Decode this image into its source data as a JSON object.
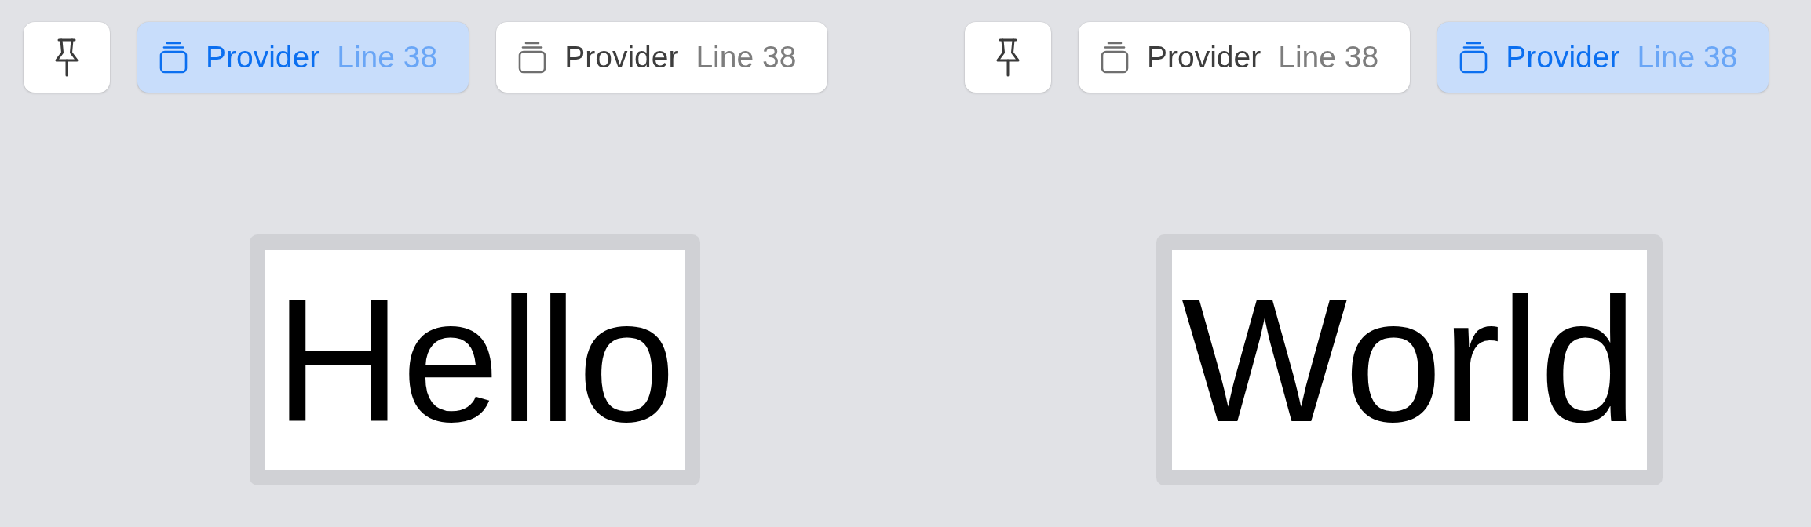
{
  "previews": [
    {
      "tabs": [
        {
          "label": "Provider",
          "detail": "Line 38",
          "selected": true
        },
        {
          "label": "Provider",
          "detail": "Line 38",
          "selected": false
        }
      ],
      "content": "Hello"
    },
    {
      "tabs": [
        {
          "label": "Provider",
          "detail": "Line 38",
          "selected": false
        },
        {
          "label": "Provider",
          "detail": "Line 38",
          "selected": true
        }
      ],
      "content": "World"
    }
  ]
}
